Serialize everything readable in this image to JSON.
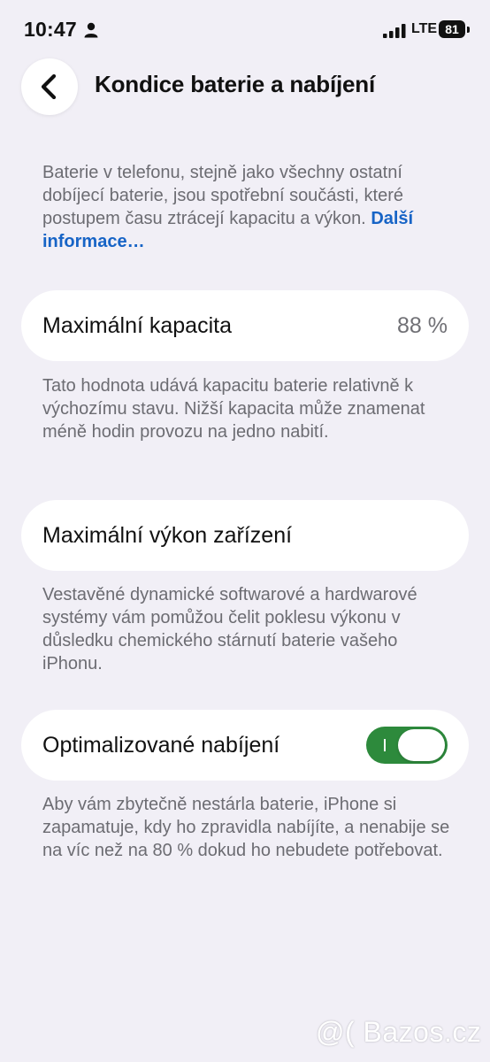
{
  "status_bar": {
    "time": "10:47",
    "network": "LTE",
    "battery_level": "81"
  },
  "nav": {
    "title": "Kondice baterie a nabíjení"
  },
  "intro": {
    "text": "Baterie v telefonu, stejně jako všechny ostatní dobíjecí baterie, jsou spotřební součásti, které postupem času ztrácejí kapacitu a výkon.",
    "link": "Další informace…"
  },
  "max_capacity": {
    "label": "Maximální kapacita",
    "value": "88 %",
    "description": "Tato hodnota udává kapacitu baterie relativně k výchozímu stavu. Nižší kapacita může znamenat méně hodin provozu na jedno nabití."
  },
  "peak_performance": {
    "label": "Maximální výkon zařízení",
    "description": "Vestavěné dynamické softwarové a hardwarové systémy vám pomůžou čelit poklesu výkonu v důsledku chemického stárnutí baterie vašeho iPhonu."
  },
  "optimized_charging": {
    "label": "Optimalizované nabíjení",
    "enabled": true,
    "description": "Aby vám zbytečně nestárla baterie, iPhone si zapamatuje, kdy ho zpravidla nabíjíte, a nenabije se na víc než na 80 % dokud ho nebudete potřebovat."
  },
  "watermark": "@( Bazos.cz",
  "colors": {
    "background": "#f1eff6",
    "link": "#1764c6",
    "toggle_on": "#2d8a3c",
    "secondary_text": "#6c6c72"
  },
  "icons": {
    "person": "person-icon",
    "signal": "cellular-signal-icon",
    "battery": "battery-icon",
    "back": "chevron-left-icon"
  }
}
